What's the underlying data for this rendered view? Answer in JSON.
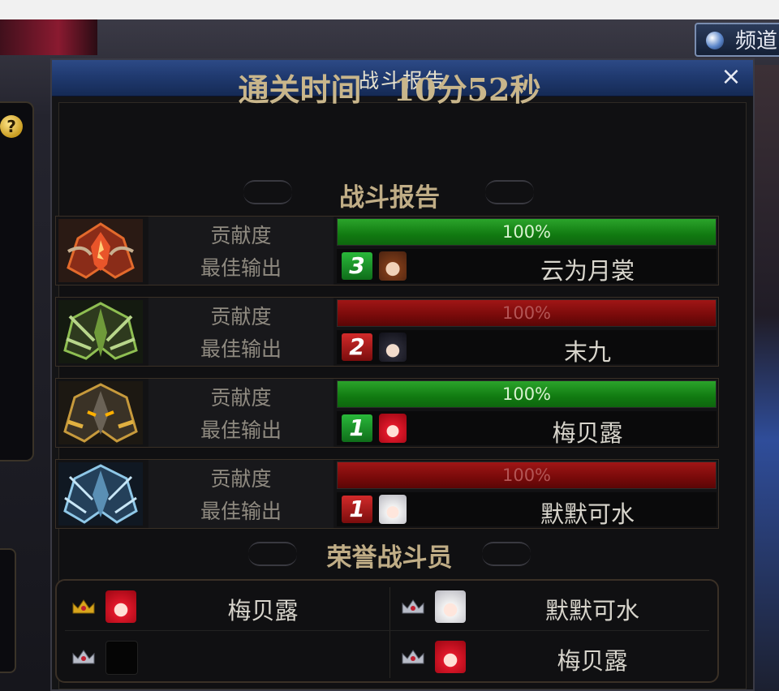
{
  "background": {
    "channel_button": "频道"
  },
  "dialog": {
    "title": "战斗报告",
    "close_symbol": "×",
    "clear_time_label": "通关时间",
    "clear_time_value": "10分52秒",
    "report_header": "战斗报告",
    "contribution_label": "贡献度",
    "best_output_label": "最佳输出",
    "players": [
      {
        "emblem": "flame-class-emblem-icon",
        "contribution": "100%",
        "contribution_fraction": 1.0,
        "bar_color": "#1e8f1e",
        "rank": "3",
        "rank_color": "#1fa22f",
        "avatar": "brown-hair-avatar-icon",
        "name": "云为月裳"
      },
      {
        "emblem": "green-blade-class-emblem-icon",
        "contribution": "100%",
        "contribution_fraction": 1.0,
        "bar_color": "#8a0e0e",
        "rank": "2",
        "rank_color": "#c01e1e",
        "avatar": "dark-hair-avatar-icon",
        "name": "末九"
      },
      {
        "emblem": "gold-armor-class-emblem-icon",
        "contribution": "100%",
        "contribution_fraction": 1.0,
        "bar_color": "#1e8f1e",
        "rank": "1",
        "rank_color": "#1fa22f",
        "avatar": "red-hair-avatar-icon",
        "name": "梅贝露"
      },
      {
        "emblem": "ice-armor-class-emblem-icon",
        "contribution": "100%",
        "contribution_fraction": 1.0,
        "bar_color": "#8a0e0e",
        "rank": "1",
        "rank_color": "#c01e1e",
        "avatar": "white-hair-avatar-icon",
        "name": "默默可水"
      }
    ],
    "honor_header": "荣誉战斗员",
    "honor": [
      {
        "crown": "gold-crown-icon",
        "avatar": "red-hair-avatar-icon",
        "name": "梅贝露"
      },
      {
        "crown": "silver-crown-icon",
        "avatar": "white-hair-avatar-icon",
        "name": "默默可水"
      },
      {
        "crown": "silver-crown-icon",
        "avatar": "empty-avatar-icon",
        "name": ""
      },
      {
        "crown": "silver-crown-icon",
        "avatar": "red-hair-avatar-icon",
        "name": "梅贝露"
      }
    ]
  }
}
